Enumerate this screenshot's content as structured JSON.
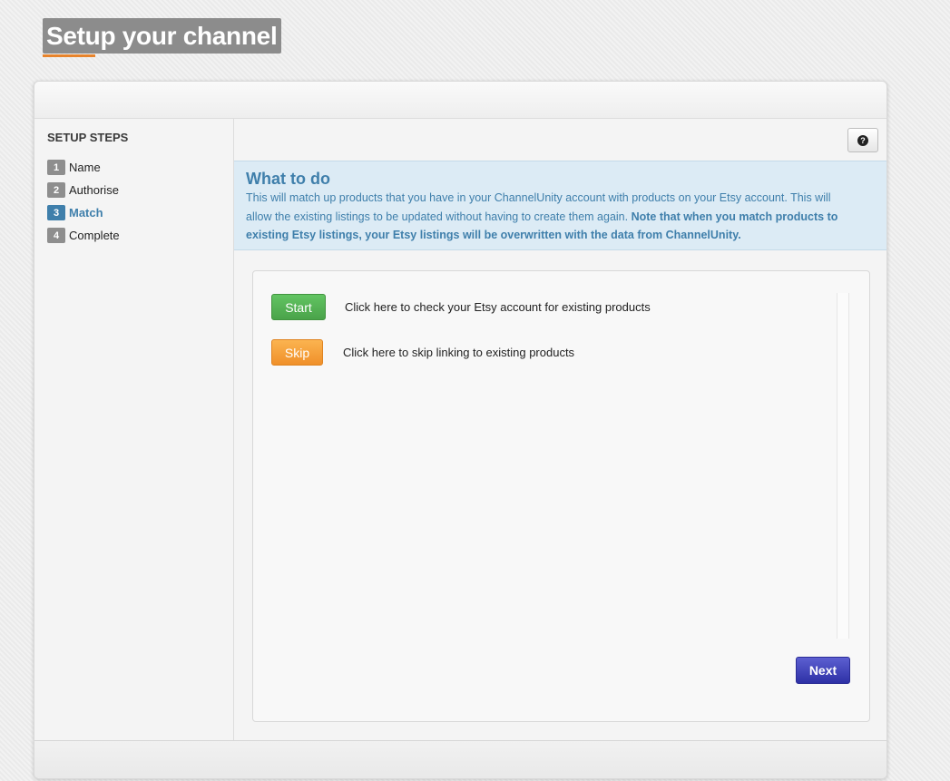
{
  "page": {
    "title": "Setup your channel"
  },
  "sidebar": {
    "title": "SETUP STEPS",
    "steps": [
      {
        "num": "1",
        "label": "Name"
      },
      {
        "num": "2",
        "label": "Authorise"
      },
      {
        "num": "3",
        "label": "Match",
        "active": true
      },
      {
        "num": "4",
        "label": "Complete"
      }
    ]
  },
  "help": {
    "icon": "question-icon",
    "glyph": "?"
  },
  "info": {
    "title": "What to do",
    "text": "This will match up products that you have in your ChannelUnity account with products on your Etsy account. This will allow the existing listings to be updated without having to create them again.",
    "bold_text": "Note that when you match products to existing Etsy listings, your Etsy listings will be overwritten with the data from ChannelUnity."
  },
  "actions": {
    "start_label": "Start",
    "start_description": "Click here to check your Etsy account for existing products",
    "skip_label": "Skip",
    "skip_description": "Click here to skip linking to existing products",
    "next_label": "Next"
  },
  "colors": {
    "accent_blue": "#3f7fab",
    "start_green": "#4aa34a",
    "skip_orange": "#f0902a",
    "next_blue": "#2e31a6",
    "title_underline": "#e8842c"
  }
}
